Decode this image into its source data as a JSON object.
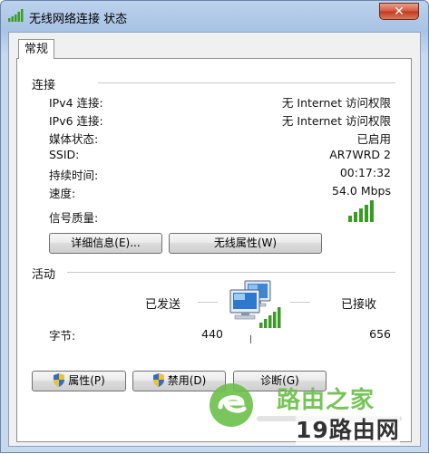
{
  "window": {
    "title": "无线网络连接 状态",
    "close_label": "✕"
  },
  "tabs": [
    {
      "label": "常规"
    }
  ],
  "connection": {
    "section_label": "连接",
    "rows": [
      {
        "label": "IPv4 连接:",
        "value": "无 Internet 访问权限"
      },
      {
        "label": "IPv6 连接:",
        "value": "无 Internet 访问权限"
      },
      {
        "label": "媒体状态:",
        "value": "已启用"
      },
      {
        "label": "SSID:",
        "value": "AR7WRD 2"
      },
      {
        "label": "持续时间:",
        "value": "00:17:32"
      },
      {
        "label": "速度:",
        "value": "54.0 Mbps"
      }
    ],
    "signal_label": "信号质量:",
    "signal_bars": 5,
    "signal_color": "#3a9d23",
    "details_button": "详细信息(E)...",
    "wireless_props_button": "无线属性(W)"
  },
  "activity": {
    "section_label": "活动",
    "sent_label": "已发送",
    "received_label": "已接收",
    "bytes_label": "字节:",
    "bytes_sent": "440",
    "bytes_received": "656"
  },
  "bottom_buttons": {
    "properties": "属性(P)",
    "disable": "禁用(D)",
    "diagnose": "诊断(G)"
  },
  "watermark": {
    "brand_text": "路由之家",
    "site_text": "19路由网"
  }
}
